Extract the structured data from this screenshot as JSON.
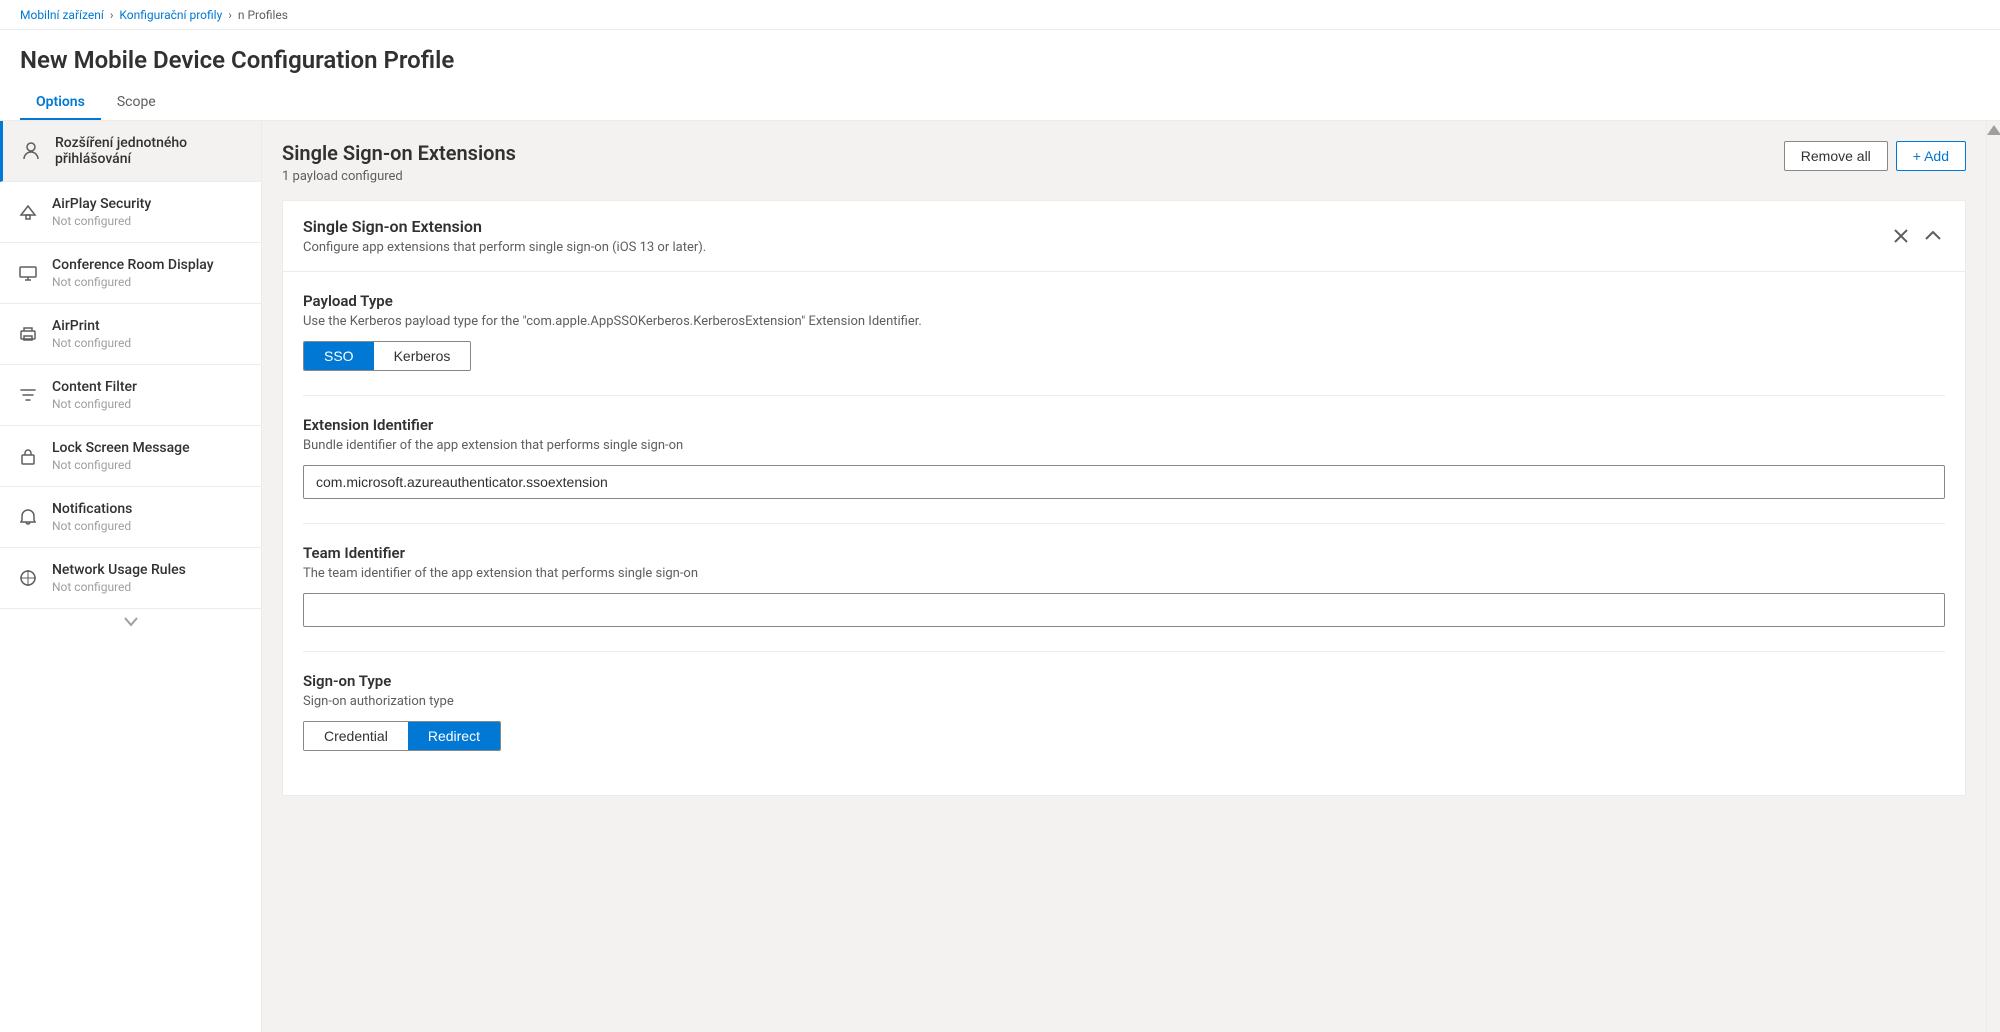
{
  "breadcrumb": {
    "items": [
      "Mobilní zařízení",
      "Konfigurační profily",
      "n Profiles"
    ]
  },
  "page_title": "New Mobile Device Configuration Profile",
  "tabs": [
    {
      "id": "options",
      "label": "Options",
      "active": true
    },
    {
      "id": "scope",
      "label": "Scope",
      "active": false
    }
  ],
  "sidebar": {
    "scroll_up_label": "▲",
    "scroll_down_label": "▼",
    "items": [
      {
        "id": "single-sign-on-extensions",
        "icon": "person-icon",
        "icon_char": "⌀",
        "title": "Rozšíření jednotného přihlášování",
        "subtitle": "",
        "active": true
      },
      {
        "id": "airplay-security",
        "icon": "airplay-security-icon",
        "icon_char": "△",
        "title": "AirPlay Security",
        "subtitle": "Not configured"
      },
      {
        "id": "conference-room-display",
        "icon": "conference-icon",
        "icon_char": "▭",
        "title": "Conference Room Display",
        "subtitle": "Not configured"
      },
      {
        "id": "airprint",
        "icon": "airprint-icon",
        "icon_char": "⬡",
        "title": "AirPrint",
        "subtitle": "Not configured"
      },
      {
        "id": "content-filter",
        "icon": "content-filter-icon",
        "icon_char": "▽",
        "title": "Content Filter",
        "subtitle": "Not configured"
      },
      {
        "id": "lock-screen-message",
        "icon": "lock-screen-icon",
        "icon_char": "☐",
        "title": "Lock Screen Message",
        "subtitle": "Not configured"
      },
      {
        "id": "notifications",
        "icon": "notifications-icon",
        "icon_char": "🔔",
        "title": "Notifications",
        "subtitle": "Not configured"
      },
      {
        "id": "network-usage-rules",
        "icon": "network-icon",
        "icon_char": "⬡",
        "title": "Network Usage Rules",
        "subtitle": "Not configured"
      }
    ]
  },
  "content": {
    "section_title": "Single Sign-on Extensions",
    "section_subtitle": "1 payload configured",
    "remove_all_label": "Remove all",
    "add_label": "+ Add",
    "card": {
      "title": "Single Sign-on Extension",
      "description": "Configure app extensions that perform single sign-on (iOS 13 or later).",
      "payload_type": {
        "label": "Payload Type",
        "description": "Use the Kerberos payload type for the \"com.apple.AppSSOKerberos.KerberosExtension\" Extension Identifier.",
        "options": [
          "SSO",
          "Kerberos"
        ],
        "active": "SSO"
      },
      "extension_identifier": {
        "label": "Extension Identifier",
        "description": "Bundle identifier of the app extension that performs single sign-on",
        "value": "com.microsoft.azureauthenticator.ssoextension",
        "placeholder": ""
      },
      "team_identifier": {
        "label": "Team Identifier",
        "description": "The team identifier of the app extension that performs single sign-on",
        "value": "",
        "placeholder": ""
      },
      "sign_on_type": {
        "label": "Sign-on Type",
        "description": "Sign-on authorization type",
        "options": [
          "Credential",
          "Redirect"
        ],
        "active": "Redirect"
      }
    }
  }
}
